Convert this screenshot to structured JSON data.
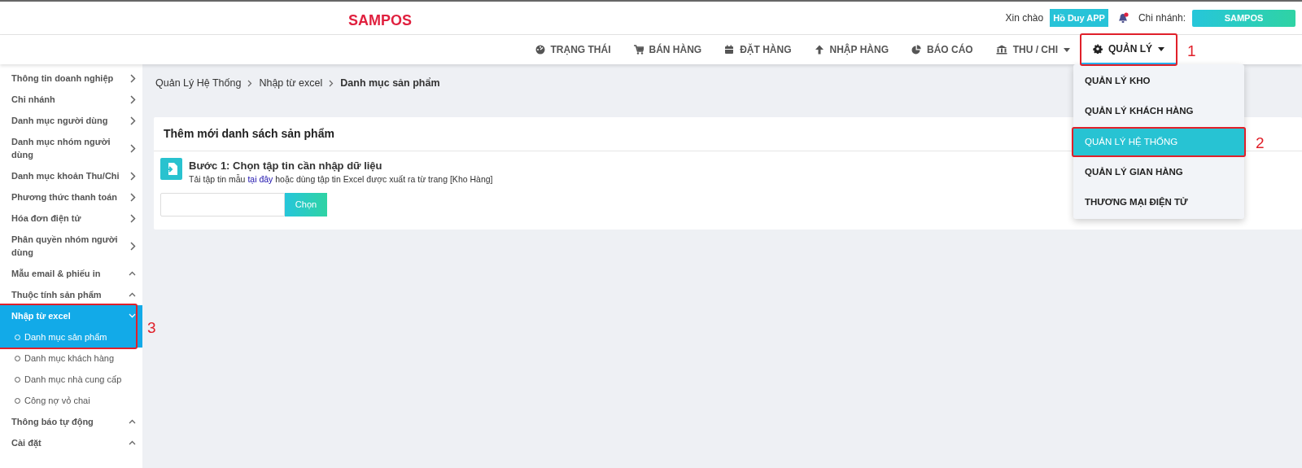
{
  "header": {
    "logo": "SAMPOS",
    "greeting": "Xin chào",
    "user": "Hồ Duy APP",
    "notification": true,
    "branch_label": "Chi nhánh:",
    "branch": "SAMPOS"
  },
  "nav": [
    {
      "label": "TRẠNG THÁI",
      "caret": false,
      "selected": false
    },
    {
      "label": "BÁN HÀNG",
      "caret": false,
      "selected": false
    },
    {
      "label": "ĐẶT HÀNG",
      "caret": false,
      "selected": false
    },
    {
      "label": "NHẬP HÀNG",
      "caret": false,
      "selected": false
    },
    {
      "label": "BÁO CÁO",
      "caret": false,
      "selected": false
    },
    {
      "label": "THU / CHI",
      "caret": true,
      "selected": false
    },
    {
      "label": "QUẢN LÝ",
      "caret": true,
      "selected": true,
      "callout": "1",
      "menu": [
        {
          "label": "QUẢN LÝ KHO",
          "selected": false
        },
        {
          "label": "QUẢN LÝ KHÁCH HÀNG",
          "selected": false
        },
        {
          "label": "QUẢN LÝ HỆ THỐNG",
          "selected": true,
          "callout": "2"
        },
        {
          "label": "QUẢN LÝ GIAN HÀNG",
          "selected": false
        },
        {
          "label": "THƯƠNG MẠI ĐIỆN TỬ",
          "selected": false
        }
      ]
    }
  ],
  "sidebar": [
    {
      "label": "Thông tin doanh nghiệp",
      "kind": "link"
    },
    {
      "label": "Chi nhánh",
      "kind": "link"
    },
    {
      "label": "Danh mục người dùng",
      "kind": "link"
    },
    {
      "label": "Danh mục nhóm người dùng",
      "kind": "link"
    },
    {
      "label": "Danh mục khoản Thu/Chi",
      "kind": "link"
    },
    {
      "label": "Phương thức thanh toán",
      "kind": "link"
    },
    {
      "label": "Hóa đơn điện tử",
      "kind": "link"
    },
    {
      "label": "Phân quyền nhóm người dùng",
      "kind": "link"
    },
    {
      "label": "Mẫu email & phiếu in",
      "kind": "group",
      "expanded": false
    },
    {
      "label": "Thuộc tính sản phẩm",
      "kind": "group",
      "expanded": false
    },
    {
      "label": "Nhập từ excel",
      "kind": "group",
      "expanded": true,
      "callout": "3",
      "children": [
        {
          "label": "Danh mục sản phẩm",
          "selected": true
        },
        {
          "label": "Danh mục khách hàng",
          "selected": false
        },
        {
          "label": "Danh mục nhà cung cấp",
          "selected": false
        },
        {
          "label": "Công nợ vỏ chai",
          "selected": false
        }
      ]
    },
    {
      "label": "Thông báo tự động",
      "kind": "group",
      "expanded": false
    },
    {
      "label": "Cài đặt",
      "kind": "group",
      "expanded": false
    }
  ],
  "breadcrumb": [
    "Quản Lý Hệ Thống",
    "Nhập từ excel",
    "Danh mục sản phẩm"
  ],
  "card": {
    "title": "Thêm mới danh sách sản phẩm",
    "step_title": "Bước 1: Chọn tập tin cần nhập dữ liệu",
    "hint_before": "Tải tập tin mẫu",
    "hint_link": "tại đây",
    "hint_after": "hoặc dùng tập tin Excel được xuất ra từ trang [Kho Hàng]",
    "button": "Chọn"
  }
}
